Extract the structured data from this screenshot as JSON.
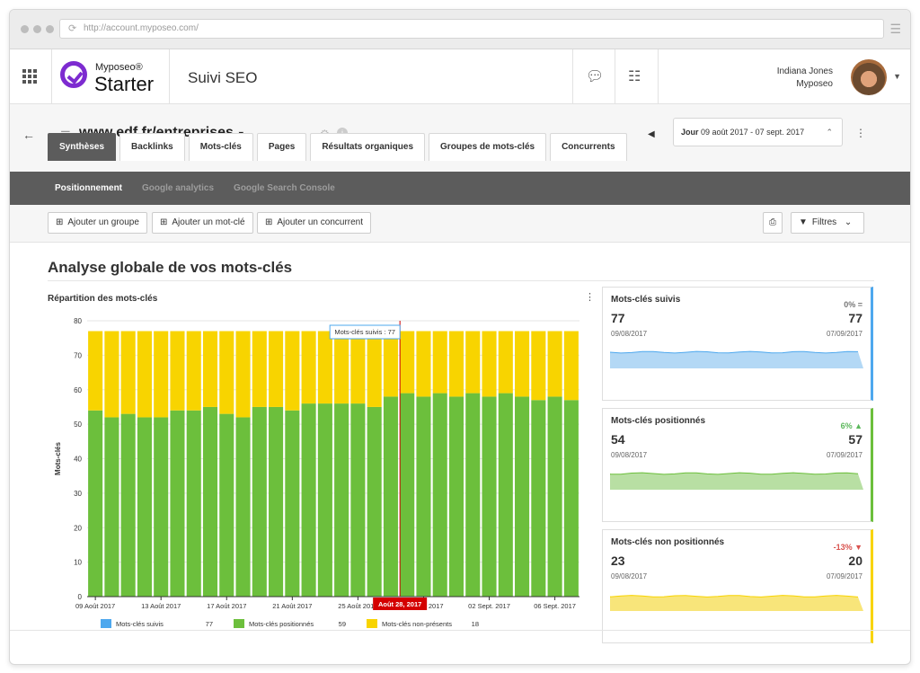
{
  "browser": {
    "url": "http://account.myposeo.com/"
  },
  "header": {
    "logo_small": "Myposeo®",
    "logo_big": "Starter",
    "app_title": "Suivi SEO",
    "user_name": "Indiana Jones",
    "user_company": "Myposeo"
  },
  "site": {
    "domain": "www.edf.fr/entreprises",
    "period_label": "Jour",
    "period_range": "09 août 2017 - 07 sept. 2017"
  },
  "tabs": [
    "Synthèses",
    "Backlinks",
    "Mots-clés",
    "Pages",
    "Résultats organiques",
    "Groupes de mots-clés",
    "Concurrents"
  ],
  "subtabs": [
    "Positionnement",
    "Google analytics",
    "Google Search Console"
  ],
  "toolbar": {
    "add_group": "Ajouter un groupe",
    "add_keyword": "Ajouter un mot-clé",
    "add_competitor": "Ajouter un concurrent",
    "filters": "Filtres"
  },
  "main": {
    "title": "Analyse globale de vos mots-clés",
    "chart_title": "Répartition des mots-clés"
  },
  "chart_data": {
    "type": "bar",
    "stacked": true,
    "ylabel": "Mots-clés",
    "ylim": [
      0,
      80
    ],
    "yticks": [
      0,
      10,
      20,
      30,
      40,
      50,
      60,
      70,
      80
    ],
    "xtick_labels": [
      "09 Août 2017",
      "13 Août 2017",
      "17 Août 2017",
      "21 Août 2017",
      "25 Août 2017",
      "29 Août 2017",
      "02 Sept. 2017",
      "06 Sept. 2017"
    ],
    "xtick_indices": [
      0,
      4,
      8,
      12,
      16,
      20,
      24,
      28
    ],
    "series": [
      {
        "name": "Mots-clés positionnés",
        "color": "#6cbf3c",
        "values": [
          54,
          52,
          53,
          52,
          52,
          54,
          54,
          55,
          53,
          52,
          55,
          55,
          54,
          56,
          56,
          56,
          56,
          55,
          58,
          59,
          58,
          59,
          58,
          59,
          58,
          59,
          58,
          57,
          58,
          57
        ]
      },
      {
        "name": "Mots-clés non-présents",
        "color": "#f8d400",
        "values": [
          23,
          25,
          24,
          25,
          25,
          23,
          23,
          22,
          24,
          25,
          22,
          22,
          23,
          21,
          21,
          21,
          21,
          22,
          19,
          18,
          19,
          18,
          19,
          18,
          19,
          18,
          19,
          20,
          19,
          20
        ]
      }
    ],
    "tooltip": "Mots-clés suivis : 77",
    "tooltip_index": 19,
    "hover_label": "Août 28, 2017",
    "legend": [
      {
        "name": "Mots-clés suivis",
        "value": "77",
        "color": "#4ea8ee"
      },
      {
        "name": "Mots-clés positionnés",
        "value": "59",
        "color": "#6cbf3c"
      },
      {
        "name": "Mots-clés non-présents",
        "value": "18",
        "color": "#f8d400"
      }
    ]
  },
  "cards": [
    {
      "title": "Mots-clés suivis",
      "change": "0% =",
      "change_color": "#777777",
      "start": "77",
      "end": "77",
      "start_date": "09/08/2017",
      "end_date": "07/09/2017",
      "color": "#4ea8ee",
      "fill": "#b3d8f5",
      "level": 0.6
    },
    {
      "title": "Mots-clés positionnés",
      "change": "6% ▲",
      "change_color": "#5cb85c",
      "start": "54",
      "end": "57",
      "start_date": "09/08/2017",
      "end_date": "07/09/2017",
      "color": "#6cbf3c",
      "fill": "#b8dfa3",
      "level": 0.6
    },
    {
      "title": "Mots-clés non positionnés",
      "change": "-13% ▼",
      "change_color": "#d9534f",
      "start": "23",
      "end": "20",
      "start_date": "09/08/2017",
      "end_date": "07/09/2017",
      "color": "#f8d400",
      "fill": "#f8e57a",
      "level": 0.55
    }
  ]
}
